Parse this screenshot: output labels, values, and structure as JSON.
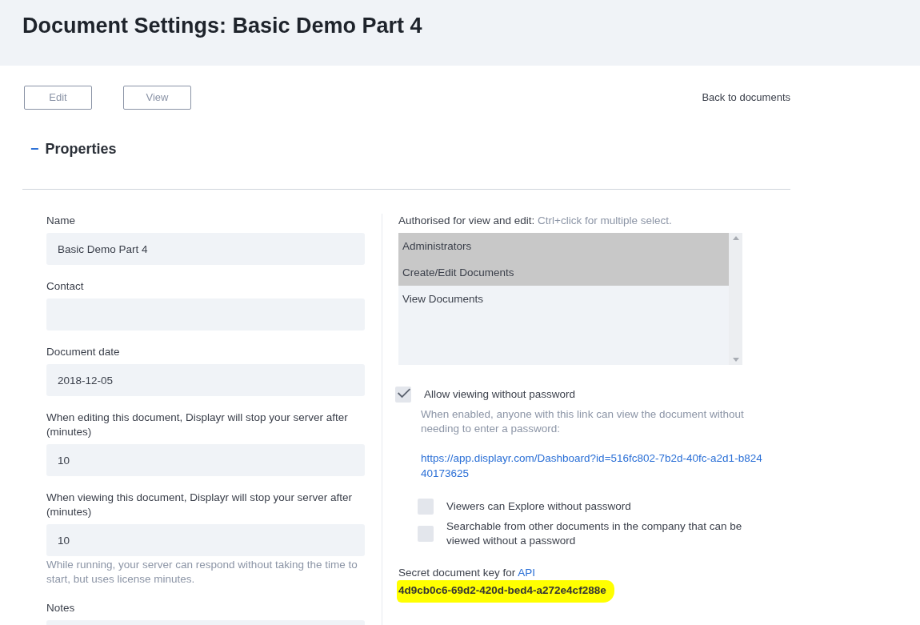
{
  "title": "Document Settings: Basic Demo Part 4",
  "buttons": [
    {
      "label": "Edit"
    },
    {
      "label": "View"
    }
  ],
  "back_link": "Back to documents",
  "section": {
    "toggle": "−",
    "title": "Properties",
    "expanded": true
  },
  "fields": [
    {
      "label": "Name",
      "value": "Basic Demo Part 4"
    },
    {
      "label": "Contact"
    },
    {
      "label": "Document date",
      "value": "2018-12-05"
    },
    {
      "label": "When editing this document, Displayr will stop your server after (minutes)",
      "value": "10"
    },
    {
      "label": "When viewing this document, Displayr will stop your server after (minutes)",
      "value": "10",
      "help": "While running, your server can respond without taking the time to start, but uses license minutes."
    },
    {
      "label": "Notes"
    }
  ],
  "access": {
    "label": "Authorised for view and edit:",
    "hint": "Ctrl+click for multiple select.",
    "options": [
      {
        "label": "Administrators",
        "selected": true
      },
      {
        "label": "Create/Edit Documents",
        "selected": true
      },
      {
        "label": "View Documents",
        "selected": false
      }
    ]
  },
  "public_access": {
    "label": "Allow viewing without password",
    "checked": true,
    "help": "When enabled, anyone with this link can view the document without needing to enter a password:",
    "link": "https://app.displayr.com/Dashboard?id=516fc802-7b2d-40fc-a2d1-b82440173625",
    "children": [
      {
        "label": "Viewers can Explore without password",
        "checked": false
      },
      {
        "label": "Searchable from other documents in the company that can be viewed without a password",
        "checked": false
      }
    ]
  },
  "api_key": {
    "label": "Secret document key for",
    "link": "API",
    "value": "4d9cb0c6-69d2-420d-bed4-a272e4cf288e",
    "highlighted": true
  }
}
